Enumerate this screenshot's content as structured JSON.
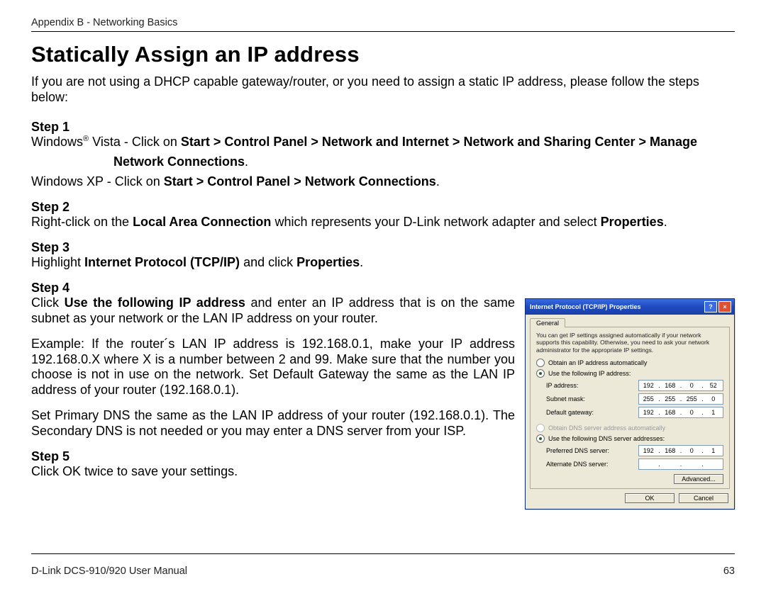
{
  "header": {
    "appendix": "Appendix B - Networking Basics"
  },
  "title": "Statically Assign an IP address",
  "intro": "If you are not using a DHCP capable gateway/router, or you need to assign a static IP address, please follow the steps below:",
  "steps": {
    "s1": {
      "label": "Step 1",
      "vista_pre": "Windows",
      "vista_sup": "®",
      "vista_mid": " Vista - Click on ",
      "vista_path": "Start > Control Panel > Network and Internet > Network and Sharing Center > Manage",
      "vista_cont": "Network Connections",
      "vista_end": ".",
      "xp_pre": "Windows XP - Click on ",
      "xp_path": "Start > Control Panel > Network Connections",
      "xp_end": "."
    },
    "s2": {
      "label": "Step 2",
      "pre": "Right-click on the ",
      "bold1": "Local Area Connection",
      "mid": " which represents your D-Link network adapter and select ",
      "bold2": "Properties",
      "end": "."
    },
    "s3": {
      "label": "Step 3",
      "pre": "Highlight ",
      "bold1": "Internet Protocol (TCP/IP)",
      "mid": " and click ",
      "bold2": "Properties",
      "end": "."
    },
    "s4": {
      "label": "Step 4",
      "pre": "Click ",
      "bold1": "Use the following IP address",
      "rest": " and enter an IP address that is on the same subnet as your network or the LAN IP address on your router.",
      "example": "Example: If the router´s LAN IP address is 192.168.0.1, make your IP address 192.168.0.X where X is a number between 2 and 99. Make sure that the number you choose is not in use on the network. Set Default Gateway the same as the LAN IP address of your router (192.168.0.1).",
      "dns": "Set Primary DNS the same as the LAN IP address of your router (192.168.0.1). The Secondary DNS is not needed or you may enter a DNS server from your ISP."
    },
    "s5": {
      "label": "Step 5",
      "text": "Click OK twice to save your settings."
    }
  },
  "dialog": {
    "title": "Internet Protocol (TCP/IP) Properties",
    "help_btn": "?",
    "close_btn": "×",
    "tab": "General",
    "hint": "You can get IP settings assigned automatically if your network supports this capability. Otherwise, you need to ask your network administrator for the appropriate IP settings.",
    "radio_auto_ip": "Obtain an IP address automatically",
    "radio_use_ip": "Use the following IP address:",
    "ip_label": "IP address:",
    "ip_value": [
      "192",
      "168",
      "0",
      "52"
    ],
    "mask_label": "Subnet mask:",
    "mask_value": [
      "255",
      "255",
      "255",
      "0"
    ],
    "gw_label": "Default gateway:",
    "gw_value": [
      "192",
      "168",
      "0",
      "1"
    ],
    "radio_auto_dns": "Obtain DNS server address automatically",
    "radio_use_dns": "Use the following DNS server addresses:",
    "pdns_label": "Preferred DNS server:",
    "pdns_value": [
      "192",
      "168",
      "0",
      "1"
    ],
    "adns_label": "Alternate DNS server:",
    "adns_value": [
      "",
      "",
      "",
      ""
    ],
    "advanced": "Advanced...",
    "ok": "OK",
    "cancel": "Cancel"
  },
  "footer": {
    "left": "D-Link DCS-910/920 User Manual",
    "page": "63"
  }
}
